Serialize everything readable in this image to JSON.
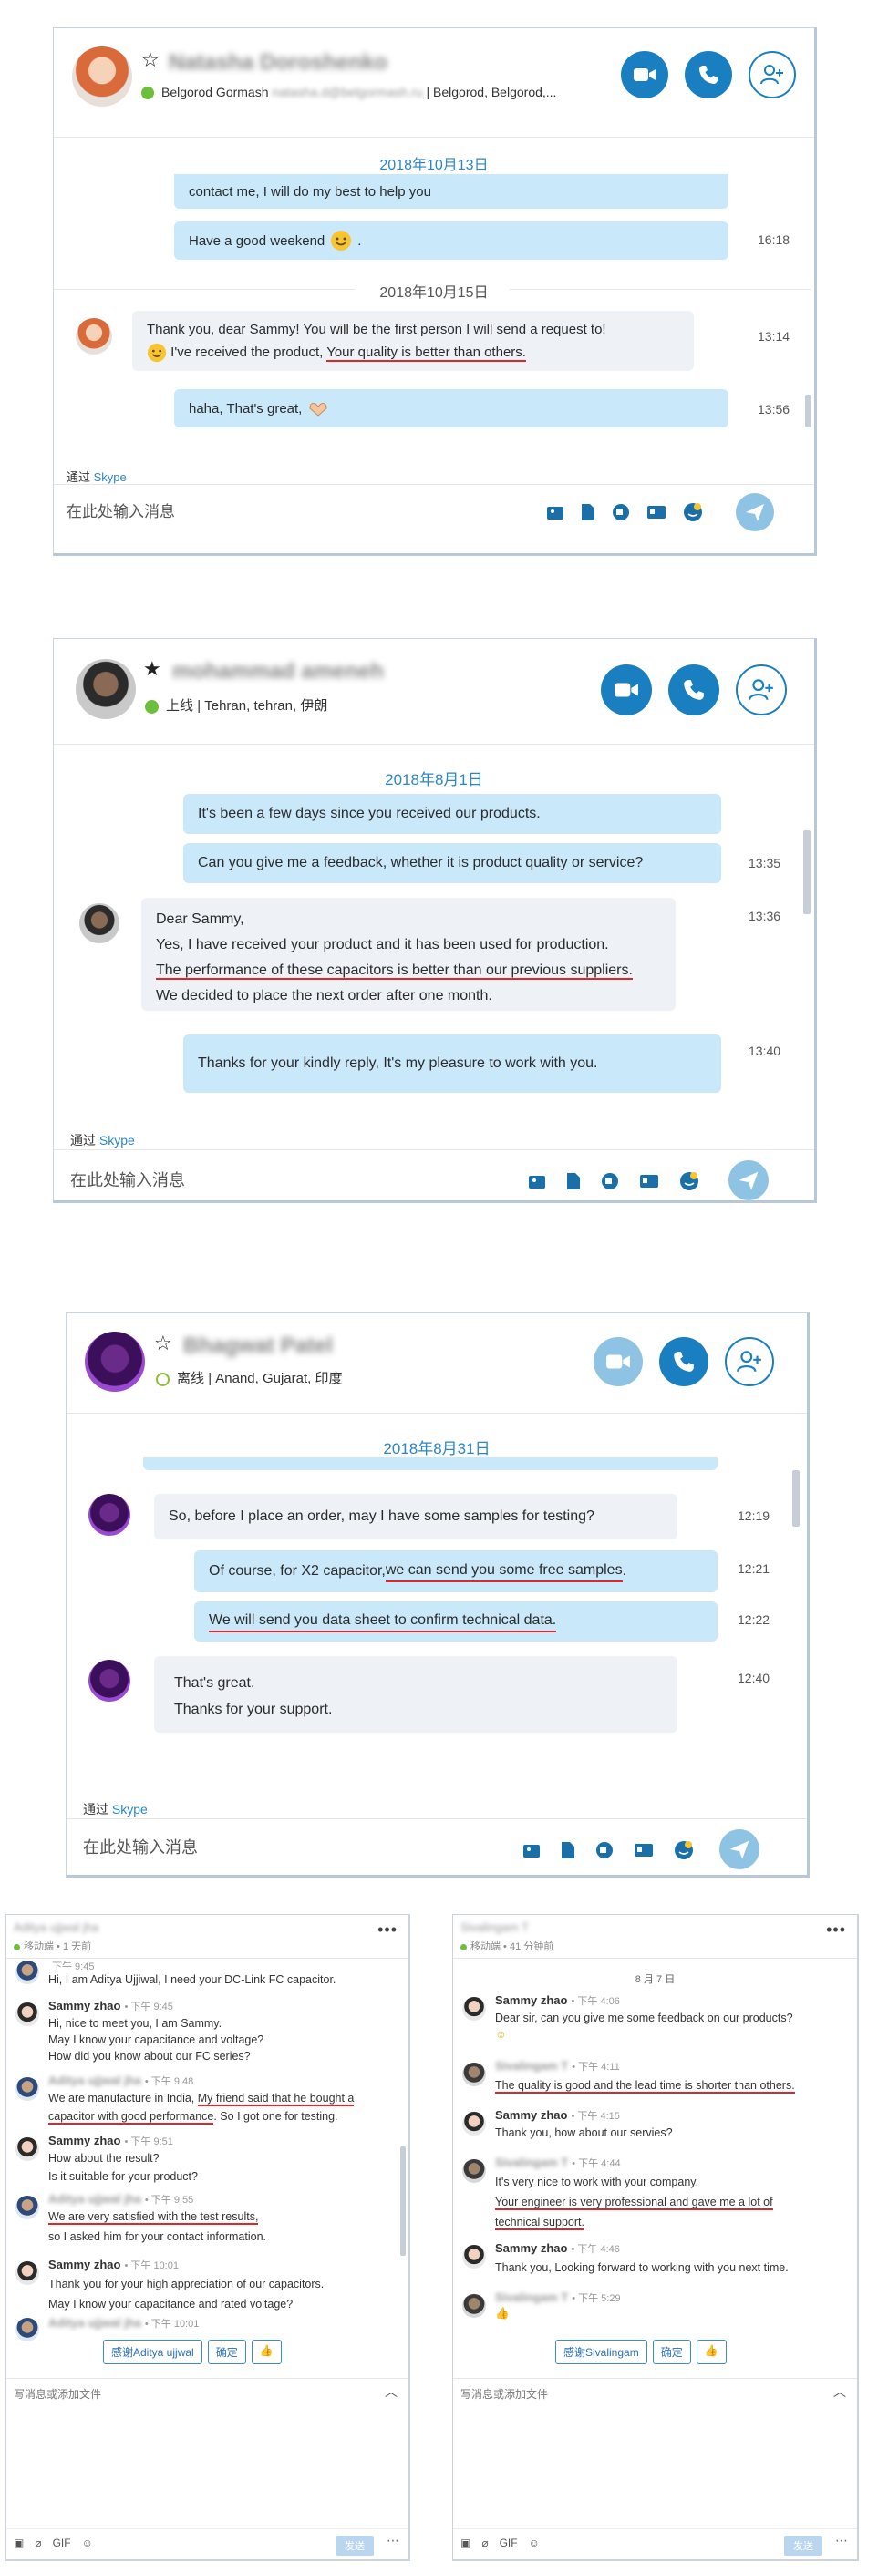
{
  "colors": {
    "skype_blue": "#1a7fc0",
    "bubble_out": "#c9e8fa",
    "bubble_in": "#eef1f5",
    "underline_red": "#e0262b",
    "date_blue": "#2a86c6"
  },
  "skype1": {
    "contact_name": "Natasha Doroshenko",
    "status": "Belgorod Gormash",
    "email": "natasha.d@belgormash.ru",
    "location": "| Belgorod, Belgorod,...",
    "date1": "2018年10月13日",
    "msg1": "contact me, I will do my best to help you",
    "msg2": "Have a good weekend",
    "time2": "16:18",
    "date2": "2018年10月15日",
    "msg3_line1": "Thank you, dear Sammy! You will be the first person I will send a request to!",
    "msg3_line2a": " I've received the product, ",
    "msg3_line2b": "Your quality is better than others.",
    "time3": "13:14",
    "msg4": "haha, That's great,",
    "time4": "13:56",
    "via_prefix": "通过",
    "via_app": "Skype",
    "placeholder": "在此处输入消息"
  },
  "skype2": {
    "contact_name": "mohammad ameneh",
    "status": "上线",
    "location": "| Tehran, tehran, 伊朗",
    "date": "2018年8月1日",
    "msg1": "It's been a few days since you received our products.",
    "msg2": "Can you give me a feedback, whether it is product quality or service?",
    "time2": "13:35",
    "in_line1": "Dear Sammy,",
    "in_line2": "Yes, I have received your product and it has been used for production.",
    "in_line3": "The performance of these capacitors is better than our previous suppliers.",
    "in_line4": "We decided to place the next order after one month.",
    "time_in": "13:36",
    "msg3": "Thanks for your kindly reply, It's my pleasure to work with you.",
    "time3": "13:40",
    "via_prefix": "通过",
    "via_app": "Skype",
    "placeholder": "在此处输入消息"
  },
  "skype3": {
    "contact_name": "Bhagwat Patel",
    "status": "离线",
    "location": "| Anand, Gujarat, 印度",
    "date": "2018年8月31日",
    "msg1": "So, before I place an order, may I have some samples for testing?",
    "time1": "12:19",
    "msg2a": "Of course, for X2 capacitor, ",
    "msg2b": "we can send you some free samples",
    "msg2c": ".",
    "time2": "12:21",
    "msg3": "We will send you data sheet  to confirm technical data.",
    "time3": "12:22",
    "msg4_line1": "That's great.",
    "msg4_line2": "Thanks for your support.",
    "time4": "12:40",
    "via_prefix": "通过",
    "via_app": "Skype",
    "placeholder": "在此处输入消息"
  },
  "qq_left": {
    "title": "Aditya ujjwal jha",
    "subtitle": "移动端 • 1 天前",
    "m0_time": "下午 9:45",
    "m0_text": "Hi, I am Aditya Ujjiwal, I need your DC-Link FC capacitor.",
    "m1_name": "Sammy zhao",
    "m1_time": "• 下午 9:45",
    "m1_l1": "Hi, nice to meet you, I am Sammy.",
    "m1_l2": "May I know your capacitance and voltage?",
    "m1_l3": "How did you know about our FC series?",
    "m2_name": "Aditya ujjwal jha",
    "m2_time": "• 下午 9:48",
    "m2_l1a": "We are manufacture in India, ",
    "m2_l1b": "My friend said that he bought a",
    "m2_l2a": "capacitor with good performance",
    "m2_l2b": ". So I got one for testing.",
    "m3_name": "Sammy zhao",
    "m3_time": "• 下午 9:51",
    "m3_l1": "How about the result?",
    "m3_l2": "Is it suitable for your product?",
    "m4_name": "Aditya ujjwal jha",
    "m4_time": "• 下午 9:55",
    "m4_l1": "We are very satisfied with the test results,",
    "m4_l2": "so I asked him for your contact information.",
    "m5_name": "Sammy zhao",
    "m5_time": "• 下午 10:01",
    "m5_l1": "Thank you for your high appreciation of our capacitors.",
    "m5_l2": "May I know your capacitance and rated voltage?",
    "m6_name": "Aditya ujjwal jha",
    "m6_time": "• 下午 10:01",
    "btn_thanks": "感谢Aditya ujjwal",
    "btn_ok": "确定",
    "btn_like": "👍",
    "placeholder": "写消息或添加文件",
    "gif": "GIF",
    "send": "发送"
  },
  "qq_right": {
    "title": "Sivalingam T",
    "subtitle": "移动端 • 41 分钟前",
    "date": "8 月 7 日",
    "m1_name": "Sammy zhao",
    "m1_time": "• 下午 4:06",
    "m1_l1": "Dear sir, can you give me some feedback on our products?",
    "m2_name": "Sivalingam T",
    "m2_time": "• 下午 4:11",
    "m2_l1": "The quality is good and the lead time is shorter than others.",
    "m3_name": "Sammy zhao",
    "m3_time": "• 下午 4:15",
    "m3_l1": "Thank you, how about our servies?",
    "m4_name": "Sivalingam T",
    "m4_time": "• 下午 4:44",
    "m4_l1": "It's very nice to work with your company.",
    "m4_l2": "Your engineer is very professional and gave me a lot of",
    "m4_l3": "technical support.",
    "m5_name": "Sammy zhao",
    "m5_time": "• 下午 4:46",
    "m5_l1": "Thank you, Looking forward to working with you next time.",
    "m6_name": "Sivalingam T",
    "m6_time": "• 下午 5:29",
    "btn_thanks": "感谢Sivalingam",
    "btn_ok": "确定",
    "btn_like": "👍",
    "placeholder": "写消息或添加文件",
    "gif": "GIF",
    "send": "发送"
  }
}
